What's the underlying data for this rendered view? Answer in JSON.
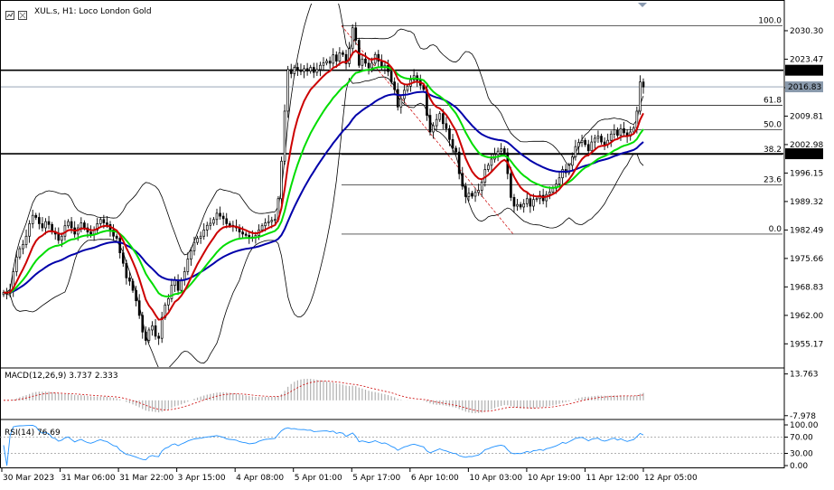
{
  "chart_data": [
    {
      "type": "candlestick",
      "title": "XUL.s, H1: Loco London Gold",
      "symbol": "XUL.s",
      "timeframe": "H1",
      "description": "Loco London Gold",
      "ylim": [
        1949.6,
        2036.8
      ],
      "yticks": [
        "2030.30",
        "2023.47",
        "2016.64",
        "2009.81",
        "2002.98",
        "1996.15",
        "1989.32",
        "1982.49",
        "1975.66",
        "1968.83",
        "1962.00",
        "1955.17"
      ],
      "x_labels": [
        "30 Mar 2023",
        "31 Mar 06:00",
        "31 Mar 22:00",
        "3 Apr 15:00",
        "4 Apr 08:00",
        "5 Apr 01:00",
        "5 Apr 17:00",
        "6 Apr 10:00",
        "10 Apr 03:00",
        "10 Apr 19:00",
        "11 Apr 12:00",
        "12 Apr 05:00"
      ],
      "horizontal_lines": [
        {
          "price": 2020.82,
          "label": "2020.82",
          "color": "#000000"
        },
        {
          "price": 2000.78,
          "label": "2000.78",
          "color": "#000000"
        }
      ],
      "current_price": {
        "price": 2016.83,
        "label": "2016.83"
      },
      "fibonacci": {
        "high": 2031.5,
        "low": 1981.5,
        "levels": [
          {
            "label": "100.0",
            "price": 2031.5
          },
          {
            "label": "61.8",
            "price": 2012.4
          },
          {
            "label": "50.0",
            "price": 2006.5
          },
          {
            "label": "38.2",
            "price": 2000.6
          },
          {
            "label": "23.6",
            "price": 1993.3
          },
          {
            "label": "0.0",
            "price": 1981.5
          }
        ]
      },
      "series": [
        {
          "type": "bollinger",
          "color": "#000000"
        },
        {
          "type": "ma",
          "color": "#cc0000"
        },
        {
          "type": "ma",
          "color": "#00dd00"
        },
        {
          "type": "ma",
          "color": "#0000aa"
        }
      ],
      "close": [
        1967.5,
        1967.2,
        1968,
        1972.5,
        1976,
        1978,
        1979,
        1981,
        1984,
        1986,
        1985.5,
        1984,
        1983,
        1984.5,
        1983.8,
        1982,
        1981.5,
        1980,
        1981,
        1983.5,
        1984.5,
        1983,
        1981.5,
        1983,
        1984.2,
        1983,
        1982,
        1981.5,
        1982.5,
        1984,
        1985,
        1984.2,
        1983.8,
        1982.5,
        1981,
        1980.5,
        1977,
        1974.5,
        1971,
        1970.2,
        1968,
        1965.5,
        1962,
        1958,
        1956,
        1958.5,
        1959.5,
        1957,
        1956.5,
        1961.5,
        1964.5,
        1966,
        1969.2,
        1970.5,
        1968,
        1970.5,
        1972.5,
        1975.5,
        1977.5,
        1979.5,
        1980.5,
        1981,
        1982.5,
        1983.6,
        1984.1,
        1985,
        1986.5,
        1985.8,
        1985.2,
        1984,
        1983.6,
        1983.4,
        1983,
        1982,
        1981.5,
        1981.2,
        1980.5,
        1980.8,
        1981.2,
        1982.5,
        1983.5,
        1984.2,
        1984.5,
        1984.8,
        1985,
        1990,
        1999,
        2011,
        2021,
        2020,
        2021.5,
        2020.8,
        2020.5,
        2021.2,
        2020.6,
        2021.5,
        2020.3,
        2021,
        2022,
        2022.6,
        2023,
        2022.5,
        2024.5,
        2023,
        2025,
        2024.6,
        2022.4,
        2026,
        2031,
        2028,
        2022,
        2023.5,
        2022.5,
        2021.4,
        2022.5,
        2024.6,
        2023,
        2021.5,
        2022,
        2020.5,
        2018,
        2016.2,
        2012,
        2014,
        2016,
        2017,
        2018.5,
        2019.5,
        2018.4,
        2017.2,
        2016.2,
        2010,
        2006,
        2007.5,
        2009,
        2010.4,
        2008,
        2006.8,
        2004.2,
        2002.1,
        2001.2,
        1996,
        1993,
        1990.5,
        1991.3,
        1990.6,
        1991.5,
        1992,
        1994,
        1997,
        1998,
        1999.5,
        2000.6,
        2001.4,
        2002,
        2001,
        1996,
        1990.3,
        1988.2,
        1988.6,
        1988,
        1988.8,
        1990,
        1988.2,
        1989.8,
        1990,
        1990.8,
        1989.5,
        1991,
        1991.6,
        1992.5,
        1993.5,
        1995,
        1997,
        1996.2,
        1998,
        2000,
        2002.5,
        2003.5,
        2004,
        2003,
        2001.5,
        2003.6,
        2004.5,
        2005,
        2003.6,
        2003,
        2004,
        2005.5,
        2006.5,
        2005.2,
        2006.8,
        2005.8,
        2005,
        2006,
        2007,
        2011,
        2018,
        2016.8
      ]
    },
    {
      "type": "bar",
      "title": "MACD(12,26,9) 3.737 2.333",
      "name": "MACD",
      "params": "12,26,9",
      "main": 3.737,
      "signal": 2.333,
      "yticks": [
        "13.763",
        "-7.978"
      ],
      "ylim": [
        -9.5,
        15
      ]
    },
    {
      "type": "line",
      "title": "RSI(14) 76.69",
      "name": "RSI",
      "params": "14",
      "value": 76.69,
      "yticks": [
        "100.00",
        "70.00",
        "30.00",
        "0.00"
      ],
      "ylim": [
        0,
        100
      ],
      "levels": [
        70,
        30
      ]
    }
  ]
}
